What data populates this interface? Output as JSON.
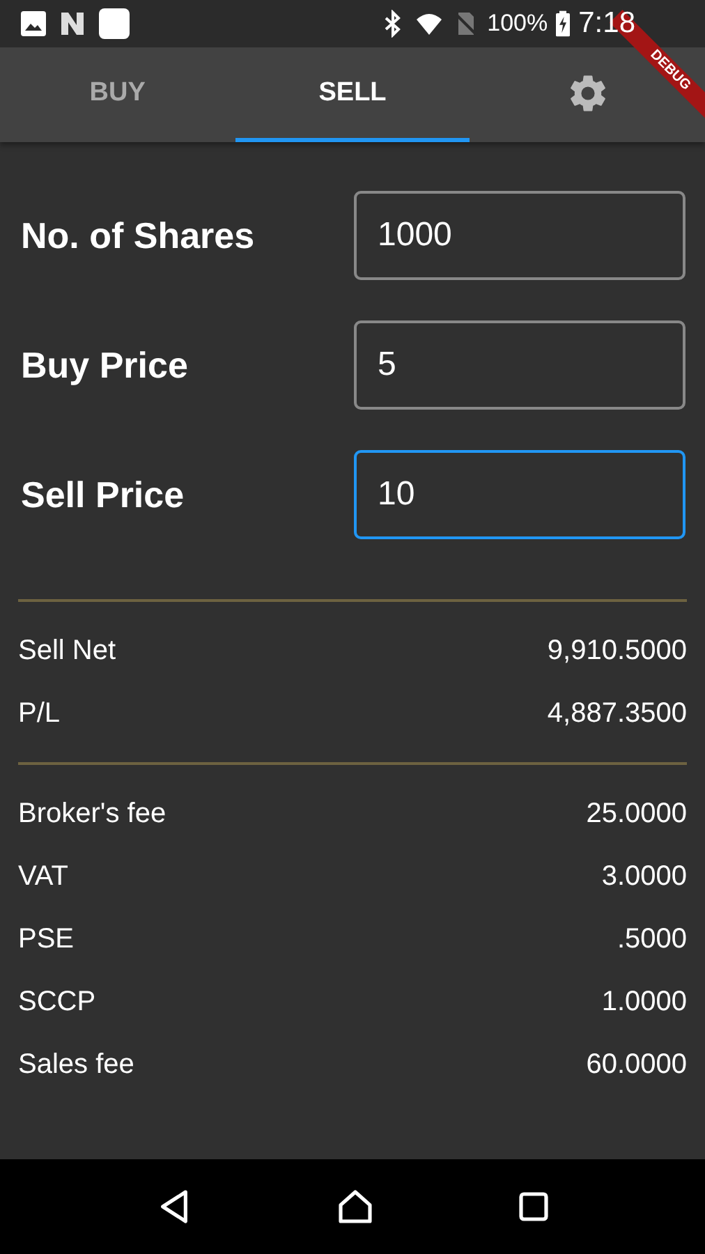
{
  "status_bar": {
    "battery": "100%",
    "time": "7:18"
  },
  "debug_banner": "DEBUG",
  "tabs": [
    {
      "kind": "text",
      "label": "BUY",
      "selected": false
    },
    {
      "kind": "text",
      "label": "SELL",
      "selected": true
    },
    {
      "kind": "settings",
      "selected": false
    }
  ],
  "fields": [
    {
      "label": "No. of Shares",
      "value": "1000",
      "focused": false
    },
    {
      "label": "Buy Price",
      "value": "5",
      "focused": false
    },
    {
      "label": "Sell Price",
      "value": "10",
      "focused": true
    }
  ],
  "summary": [
    {
      "label": "Sell Net",
      "value": "9,910.5000"
    },
    {
      "label": "P/L",
      "value": "4,887.3500"
    }
  ],
  "fees": [
    {
      "label": "Broker's fee",
      "value": "25.0000"
    },
    {
      "label": "VAT",
      "value": "3.0000"
    },
    {
      "label": "PSE",
      "value": ".5000"
    },
    {
      "label": "SCCP",
      "value": "1.0000"
    },
    {
      "label": "Sales fee",
      "value": "60.0000"
    }
  ]
}
